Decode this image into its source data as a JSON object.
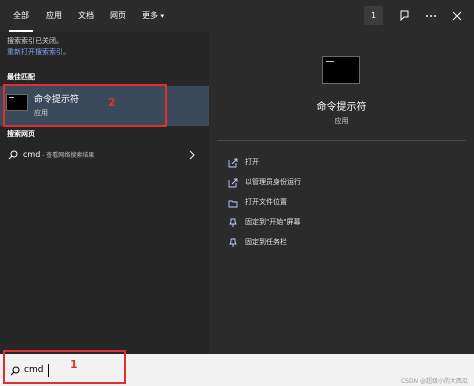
{
  "tabs": [
    {
      "label": "全部",
      "active": true
    },
    {
      "label": "应用",
      "active": false
    },
    {
      "label": "文档",
      "active": false
    },
    {
      "label": "网页",
      "active": false
    },
    {
      "label": "更多",
      "active": false
    }
  ],
  "topbar": {
    "badge": "1",
    "icons": [
      "feedback-icon",
      "more-icon",
      "close-icon"
    ]
  },
  "left": {
    "hint_text": "搜索索引已关闭。",
    "hint_link": "重新打开搜索索引。",
    "best_match_title": "最佳匹配",
    "best_match": {
      "title": "命令提示符",
      "subtitle": "应用"
    },
    "web_title": "搜索网页",
    "web_result": {
      "query": "cmd",
      "suffix": " - 查看网络搜索结果"
    }
  },
  "right": {
    "title": "命令提示符",
    "subtitle": "应用",
    "actions": [
      {
        "label": "打开",
        "icon": "open-icon"
      },
      {
        "label": "以管理员身份运行",
        "icon": "run-as-admin-icon"
      },
      {
        "label": "打开文件位置",
        "icon": "folder-icon"
      },
      {
        "label": "固定到\"开始\"屏幕",
        "icon": "pin-icon"
      },
      {
        "label": "固定到任务栏",
        "icon": "pin-icon"
      }
    ]
  },
  "search": {
    "value": "cmd"
  },
  "annotations": {
    "step1": "1",
    "step2": "2"
  },
  "watermark": "CSDN @超级小的大西瓜",
  "colors": {
    "accent_selection": "#3a4a5a",
    "annotation_red": "#e03030",
    "link_blue": "#79a8ff"
  }
}
